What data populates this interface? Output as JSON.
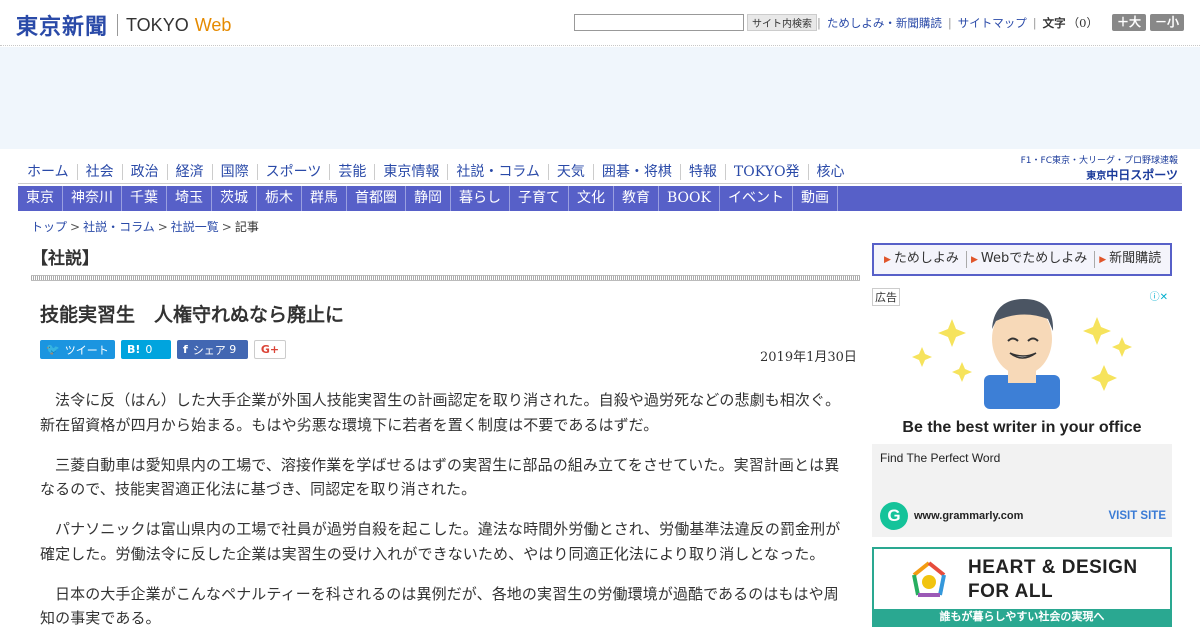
{
  "header": {
    "logo_jp": "東京新聞",
    "logo_en": "TOKYO",
    "logo_web": "Web",
    "search_button": "サイト内検索",
    "link_trial": "ためしよみ・新聞購読",
    "link_sitemap": "サイトマップ",
    "font_label": "文字",
    "font_count": "（0）",
    "font_bigger": "＋大",
    "font_smaller": "－小"
  },
  "nav_main": [
    "ホーム",
    "社会",
    "政治",
    "経済",
    "国際",
    "スポーツ",
    "芸能",
    "東京情報",
    "社説・コラム",
    "天気",
    "囲碁・将棋",
    "特報",
    "TOKYO発",
    "核心"
  ],
  "sports_logo": {
    "small": "F1・FC東京・大リーグ・プロ野球速報",
    "prefix": "東京",
    "main": "中日スポーツ"
  },
  "nav_region": [
    "東京",
    "神奈川",
    "千葉",
    "埼玉",
    "茨城",
    "栃木",
    "群馬",
    "首都圏",
    "静岡",
    "暮らし",
    "子育て",
    "文化",
    "教育",
    "BOOK",
    "イベント",
    "動画"
  ],
  "breadcrumb": [
    "トップ",
    "社説・コラム",
    "社説一覧",
    "記事"
  ],
  "article": {
    "section": "【社説】",
    "title": "技能実習生　人権守れぬなら廃止に",
    "date": "2019年1月30日",
    "share": {
      "tweet": "ツイート",
      "hatena_count": "0",
      "facebook": "シェア",
      "facebook_count": "9",
      "gplus": "G+"
    },
    "paragraphs": [
      "法令に反（はん）した大手企業が外国人技能実習生の計画認定を取り消された。自殺や過労死などの悲劇も相次ぐ。新在留資格が四月から始まる。もはや劣悪な環境下に若者を置く制度は不要であるはずだ。",
      "三菱自動車は愛知県内の工場で、溶接作業を学ばせるはずの実習生に部品の組み立てをさせていた。実習計画とは異なるので、技能実習適正化法に基づき、同認定を取り消された。",
      "パナソニックは富山県内の工場で社員が過労自殺を起こした。違法な時間外労働とされ、労働基準法違反の罰金刑が確定した。労働法令に反した企業は実習生の受け入れができないため、やはり同適正化法により取り消しとなった。",
      "日本の大手企業がこんなペナルティーを科されるのは異例だが、各地の実習生の労働環境が過酷であるのはもはや周知の事実である。"
    ]
  },
  "sidebar": {
    "links": [
      "ためしよみ",
      "Webでためしよみ",
      "新聞購読"
    ],
    "ad_label": "広告",
    "ad": {
      "headline": "Be the best writer in your office",
      "sub": "Find The Perfect Word",
      "url": "www.grammarly.com",
      "visit": "VISIT SITE",
      "g_letter": "G"
    },
    "heart": {
      "line1": "HEART & DESIGN",
      "line2": "FOR ALL",
      "bar": "誰もが暮らしやすい社会の実現へ"
    }
  },
  "colors": {
    "brand_blue": "#2a4aa8",
    "nav_purple": "#5760c8",
    "twitter": "#1b95e0",
    "hatena": "#00a4de",
    "facebook": "#4267b2",
    "heart_green": "#2aa891"
  }
}
